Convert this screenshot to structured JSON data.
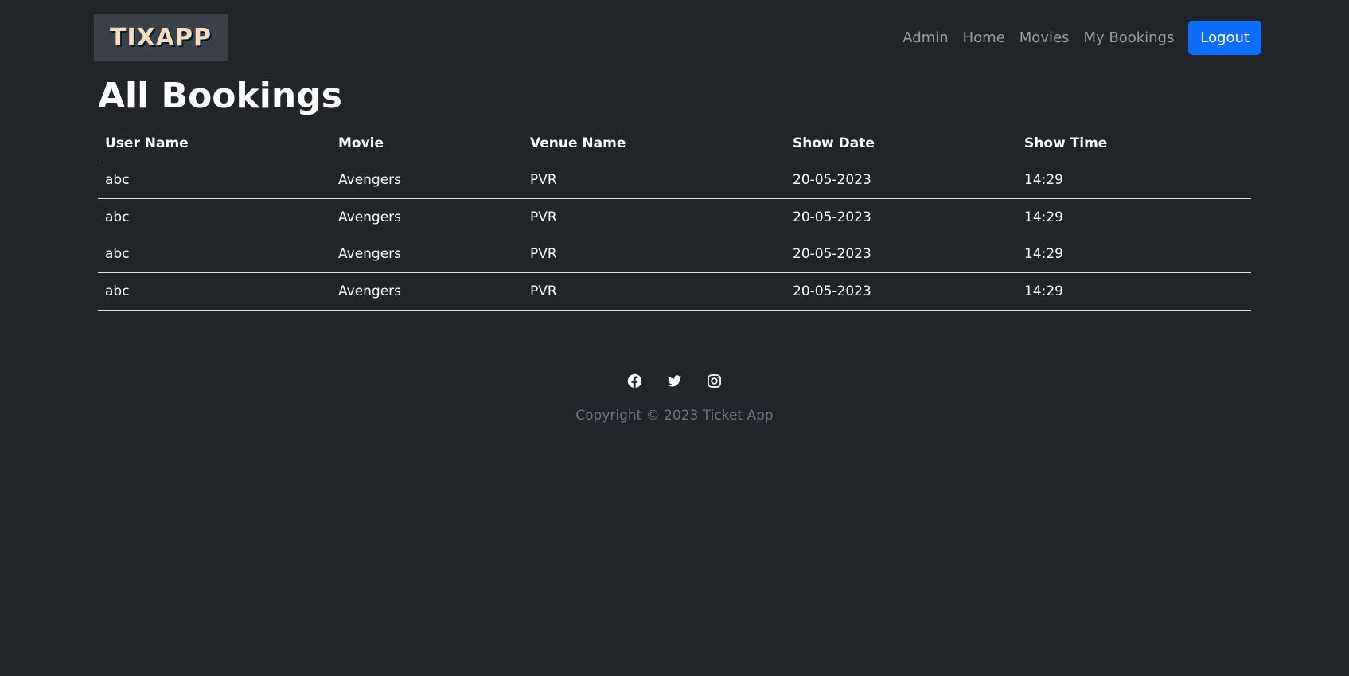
{
  "brand": {
    "logo_text": "TIXAPP"
  },
  "nav": {
    "items": [
      "Admin",
      "Home",
      "Movies",
      "My Bookings"
    ],
    "logout_label": "Logout"
  },
  "page": {
    "title": "All Bookings"
  },
  "table": {
    "headers": [
      "User Name",
      "Movie",
      "Venue Name",
      "Show Date",
      "Show Time"
    ],
    "rows": [
      [
        "abc",
        "Avengers",
        "PVR",
        "20-05-2023",
        "14:29"
      ],
      [
        "abc",
        "Avengers",
        "PVR",
        "20-05-2023",
        "14:29"
      ],
      [
        "abc",
        "Avengers",
        "PVR",
        "20-05-2023",
        "14:29"
      ],
      [
        "abc",
        "Avengers",
        "PVR",
        "20-05-2023",
        "14:29"
      ]
    ]
  },
  "footer": {
    "icons": [
      "facebook-icon",
      "twitter-icon",
      "instagram-icon"
    ],
    "copyright": "Copyright © 2023 Ticket App"
  },
  "colors": {
    "background": "#212529",
    "primary": "#0d6efd",
    "muted": "#6c757d"
  }
}
